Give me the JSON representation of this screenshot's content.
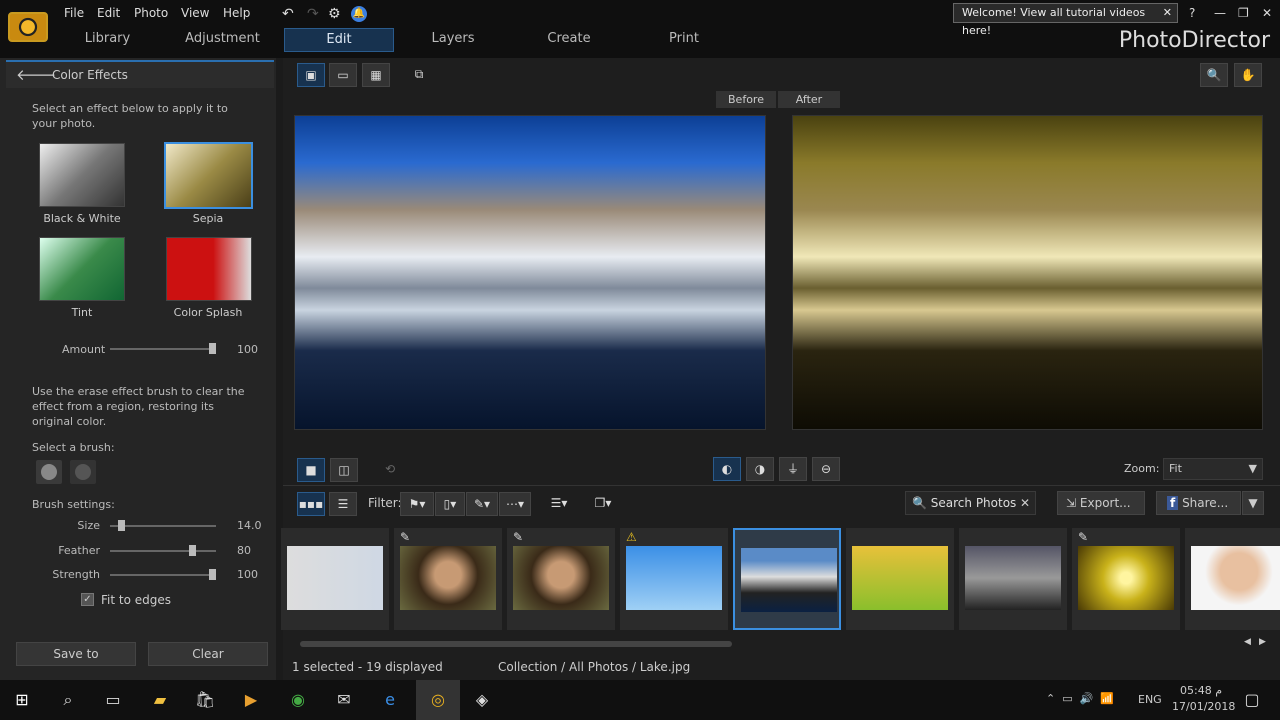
{
  "app": {
    "brand": "PhotoDirector",
    "welcome": "Welcome! View all tutorial videos here!",
    "menu": [
      "File",
      "Edit",
      "Photo",
      "View",
      "Help"
    ],
    "tabs": [
      "Library",
      "Adjustment",
      "Edit",
      "Layers",
      "Create",
      "Print"
    ],
    "active_tab": "Edit"
  },
  "panel": {
    "title": "Color Effects",
    "intro": "Select an effect below to apply it to your photo.",
    "effects": [
      {
        "label": "Black & White"
      },
      {
        "label": "Sepia",
        "selected": true
      },
      {
        "label": "Tint"
      },
      {
        "label": "Color Splash"
      }
    ],
    "amount_label": "Amount",
    "amount_value": "100",
    "amount": 100,
    "erase_text": "Use the erase effect brush to clear the effect from a region, restoring its original color.",
    "brush_label": "Select a brush:",
    "brush_settings": "Brush settings:",
    "sliders": [
      {
        "label": "Size",
        "value": "14.0",
        "pct": 8
      },
      {
        "label": "Feather",
        "value": "80",
        "pct": 80
      },
      {
        "label": "Strength",
        "value": "100",
        "pct": 100
      }
    ],
    "fit_edges": "Fit to edges",
    "fit_checked": true,
    "save": "Save to",
    "clear": "Clear"
  },
  "viewer": {
    "before": "Before",
    "after": "After",
    "zoom_label": "Zoom:",
    "zoom_value": "Fit"
  },
  "browser": {
    "filter": "Filter:",
    "search": "Search Photos",
    "export": "Export...",
    "share": "Share...",
    "status": "1 selected - 19 displayed",
    "path": "Collection / All Photos / Lake.jpg"
  },
  "thumbs": [
    {
      "bg": "linear-gradient(90deg,#ddd,#cfd8e4)",
      "mark": ""
    },
    {
      "bg": "radial-gradient(circle at 50% 45%,#c79a74 22%,#3a2a18 50%,#6a6a40)",
      "mark": "✎"
    },
    {
      "bg": "radial-gradient(circle at 50% 45%,#c79a74 22%,#3a2a18 50%,#6a6a40)",
      "mark": "✎"
    },
    {
      "bg": "linear-gradient(180deg,#3b8fe6,#9fd0f5)",
      "mark": "⚠"
    },
    {
      "bg": "linear-gradient(180deg,#5a8bc7 20%,#ddd 45%,#222 70%,#0b2142)",
      "mark": ""
    },
    {
      "bg": "linear-gradient(180deg,#e8c13a,#8abf2c)",
      "mark": ""
    },
    {
      "bg": "linear-gradient(180deg,#556,#999 50%,#222)",
      "mark": ""
    },
    {
      "bg": "radial-gradient(circle,#fff5a0 10%,#c9b21a 40%,#4a3a05)",
      "mark": "✎"
    },
    {
      "bg": "radial-gradient(circle at 50% 40%,#e8c0a0 30%,#f5f5f5 55%)",
      "mark": ""
    }
  ],
  "taskbar": {
    "lang": "ENG",
    "time": "05:48 م",
    "date": "17/01/2018"
  }
}
